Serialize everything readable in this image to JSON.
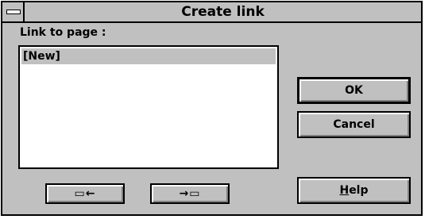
{
  "window": {
    "title": "Create link"
  },
  "labels": {
    "link_to_page": "Link to page :"
  },
  "list": {
    "items": [
      "[New]"
    ]
  },
  "buttons": {
    "ok": "OK",
    "cancel": "Cancel",
    "help_prefix": "",
    "help_mnemonic": "H",
    "help_rest": "elp",
    "link_backward": "▭←",
    "link_forward": "→▭"
  }
}
